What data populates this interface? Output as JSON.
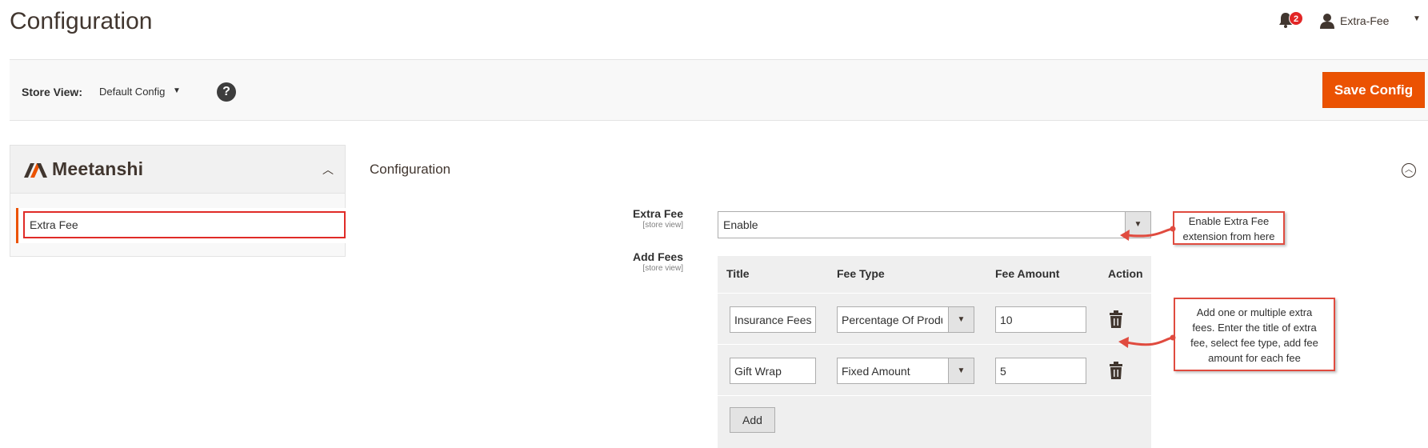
{
  "header": {
    "page_title": "Configuration",
    "notifications_count": "2",
    "user_name": "Extra-Fee"
  },
  "store_bar": {
    "label": "Store View:",
    "value": "Default Config",
    "help_icon": "?",
    "save_label": "Save Config"
  },
  "sidebar": {
    "brand_name": "Meetanshi",
    "items": [
      {
        "label": "Extra Fee"
      }
    ]
  },
  "main": {
    "section_title": "Configuration",
    "extra_fee": {
      "label": "Extra Fee",
      "scope": "[store view]",
      "value": "Enable"
    },
    "add_fees": {
      "label": "Add Fees",
      "scope": "[store view]",
      "columns": [
        "Title",
        "Fee Type",
        "Fee Amount",
        "Action"
      ],
      "rows": [
        {
          "title": "Insurance Fees",
          "fee_type": "Percentage Of Product Price",
          "fee_amount": "10"
        },
        {
          "title": "Gift Wrap",
          "fee_type": "Fixed Amount",
          "fee_amount": "5"
        }
      ],
      "add_label": "Add"
    }
  },
  "callouts": {
    "enable": [
      "Enable Extra Fee",
      "extension from here"
    ],
    "fees": [
      "Add one or multiple extra",
      "fees. Enter the title of extra",
      "fee, select fee type, add fee",
      "amount for each fee"
    ]
  },
  "colors": {
    "accent": "#eb5202",
    "callout_border": "#e04b3f",
    "active_border": "#e02b27"
  },
  "icons": [
    "bell-icon",
    "user-icon",
    "caret-down-icon",
    "help-icon",
    "meetanshi-logo",
    "chevron-up-icon",
    "trash-icon"
  ]
}
